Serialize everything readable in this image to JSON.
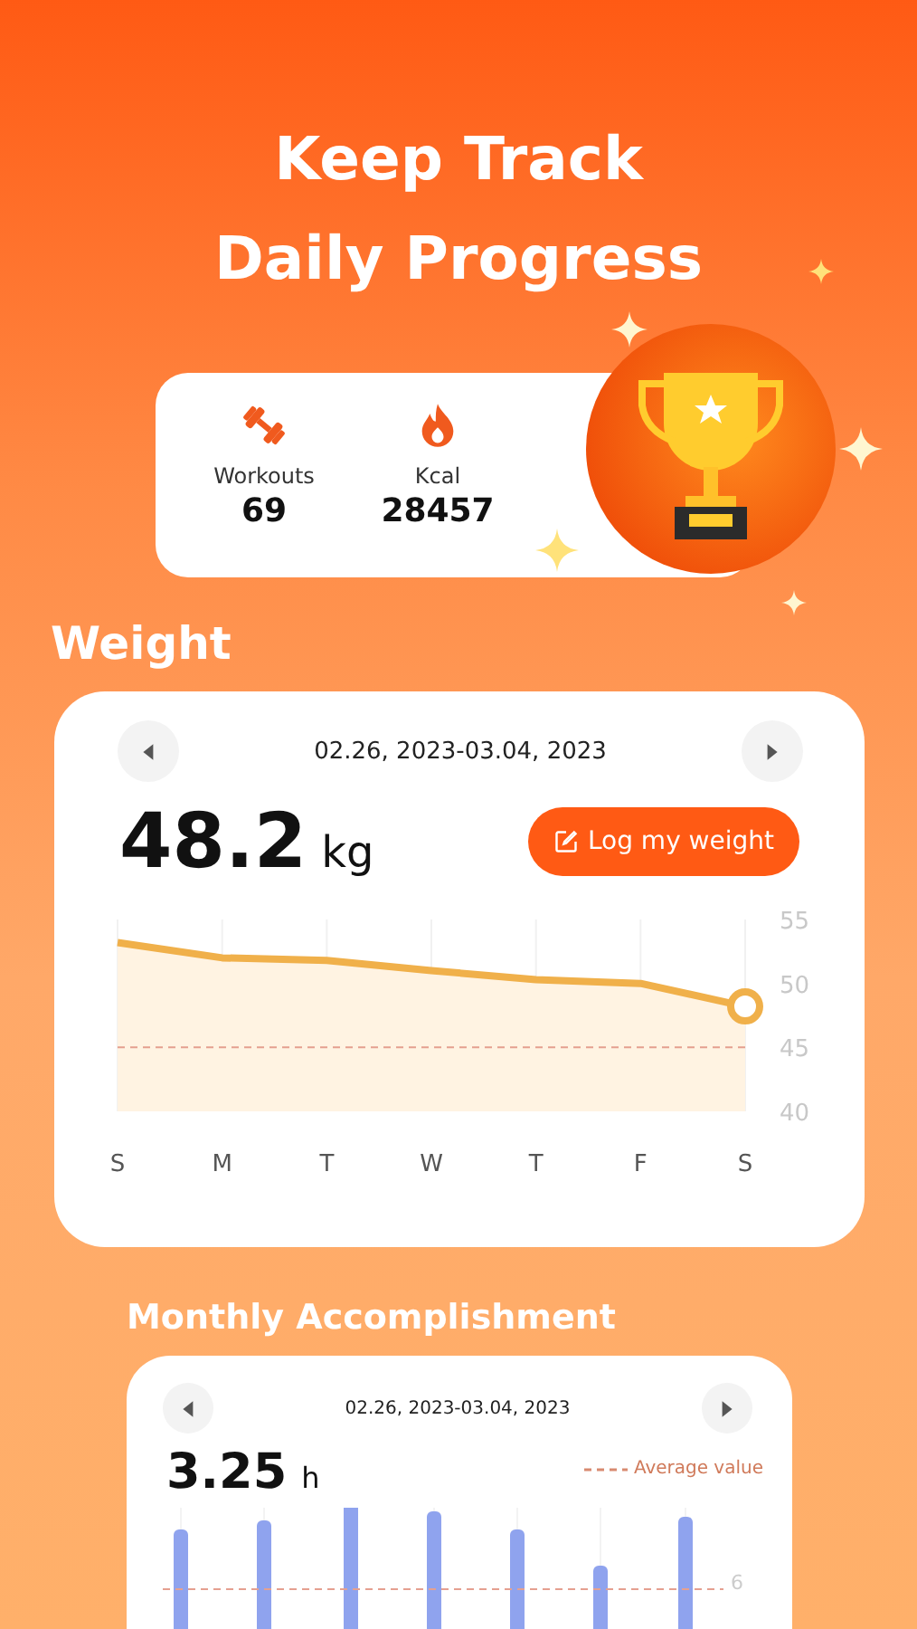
{
  "title_lines": [
    "Keep Track",
    "Daily Progress"
  ],
  "stats": [
    {
      "kind": "dumbbell",
      "label": "Workouts",
      "value": "69"
    },
    {
      "kind": "flame",
      "label": "Kcal",
      "value": "28457"
    }
  ],
  "weight": {
    "heading": "Weight",
    "date_range": "02.26, 2023-03.04, 2023",
    "value": "48.2",
    "unit": "kg",
    "log_button": "Log my weight",
    "chart_data": {
      "type": "area",
      "categories": [
        "S",
        "M",
        "T",
        "W",
        "T",
        "F",
        "S"
      ],
      "series": [
        {
          "color": "#f0b04a",
          "values": [
            53.2,
            52,
            51.8,
            51,
            50.3,
            50,
            48.2
          ]
        }
      ],
      "ylim": [
        40,
        55
      ],
      "yticks": [
        40,
        45,
        50,
        55
      ],
      "grid": true,
      "ref_lines": [
        {
          "axis": "y",
          "value": 45
        }
      ]
    }
  },
  "monthly": {
    "heading": "Monthly Accomplishment",
    "date_range": "02.26, 2023-03.04, 2023",
    "value": "3.25",
    "unit": "h",
    "legend": "Average value",
    "axis_label": "6"
  }
}
